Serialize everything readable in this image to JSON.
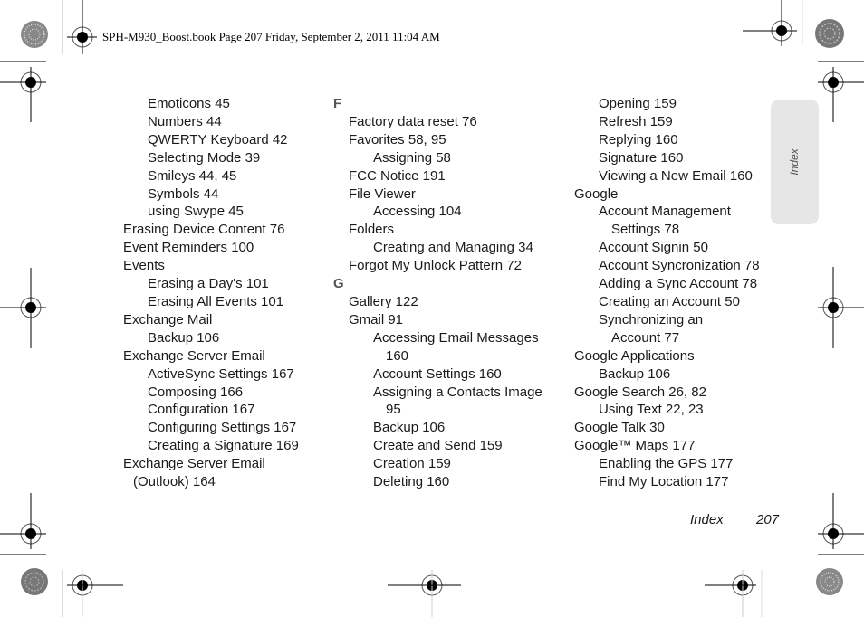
{
  "header": {
    "print_info": "SPH-M930_Boost.book  Page 207  Friday, September 2, 2011  11:04 AM"
  },
  "side_tab": {
    "label": "Index"
  },
  "footer": {
    "section": "Index",
    "page_number": "207"
  },
  "columns": [
    {
      "entries": [
        {
          "text": "Emoticons 45",
          "level": "lvl1"
        },
        {
          "text": "Numbers 44",
          "level": "lvl1"
        },
        {
          "text": "QWERTY Keyboard 42",
          "level": "lvl1"
        },
        {
          "text": "Selecting Mode 39",
          "level": "lvl1"
        },
        {
          "text": "Smileys 44, 45",
          "level": "lvl1"
        },
        {
          "text": "Symbols 44",
          "level": "lvl1"
        },
        {
          "text": "using Swype 45",
          "level": "lvl1"
        },
        {
          "text": "Erasing Device Content 76",
          "level": "lvl0"
        },
        {
          "text": "Event Reminders 100",
          "level": "lvl0"
        },
        {
          "text": "Events",
          "level": "lvl0"
        },
        {
          "text": "Erasing a Day's 101",
          "level": "lvl1"
        },
        {
          "text": "Erasing All Events 101",
          "level": "lvl1"
        },
        {
          "text": "Exchange Mail",
          "level": "lvl0"
        },
        {
          "text": "Backup 106",
          "level": "lvl1"
        },
        {
          "text": "Exchange Server Email",
          "level": "lvl0"
        },
        {
          "text": "ActiveSync Settings 167",
          "level": "lvl1"
        },
        {
          "text": "Composing 166",
          "level": "lvl1"
        },
        {
          "text": "Configuration 167",
          "level": "lvl1"
        },
        {
          "text": "Configuring Settings 167",
          "level": "lvl1"
        },
        {
          "text": "Creating a Signature 169",
          "level": "lvl1"
        },
        {
          "text": "Exchange Server Email",
          "level": "lvl0"
        },
        {
          "text": "(Outlook) 164",
          "level": "lvl0c"
        }
      ]
    },
    {
      "entries": [
        {
          "text": "F",
          "level": "letter"
        },
        {
          "text": "Factory data reset 76",
          "level": "lvl0"
        },
        {
          "text": "Favorites 58, 95",
          "level": "lvl0"
        },
        {
          "text": "Assigning 58",
          "level": "lvl1"
        },
        {
          "text": "FCC Notice 191",
          "level": "lvl0"
        },
        {
          "text": "File Viewer",
          "level": "lvl0"
        },
        {
          "text": "Accessing 104",
          "level": "lvl1"
        },
        {
          "text": "Folders",
          "level": "lvl0"
        },
        {
          "text": "Creating and Managing 34",
          "level": "lvl1"
        },
        {
          "text": "Forgot My Unlock Pattern 72",
          "level": "lvl0"
        },
        {
          "text": "G",
          "level": "letter"
        },
        {
          "text": "Gallery 122",
          "level": "lvl0"
        },
        {
          "text": "Gmail 91",
          "level": "lvl0"
        },
        {
          "text": "Accessing Email Messages",
          "level": "lvl1"
        },
        {
          "text": "160",
          "level": "lvl1c"
        },
        {
          "text": "Account Settings 160",
          "level": "lvl1"
        },
        {
          "text": "Assigning a Contacts Image",
          "level": "lvl1"
        },
        {
          "text": "95",
          "level": "lvl1c"
        },
        {
          "text": "Backup 106",
          "level": "lvl1"
        },
        {
          "text": "Create and Send 159",
          "level": "lvl1"
        },
        {
          "text": "Creation 159",
          "level": "lvl1"
        },
        {
          "text": "Deleting 160",
          "level": "lvl1"
        }
      ]
    },
    {
      "entries": [
        {
          "text": "Opening 159",
          "level": "lvl1"
        },
        {
          "text": "Refresh 159",
          "level": "lvl1"
        },
        {
          "text": "Replying 160",
          "level": "lvl1"
        },
        {
          "text": "Signature 160",
          "level": "lvl1"
        },
        {
          "text": "Viewing a New Email 160",
          "level": "lvl1"
        },
        {
          "text": "Google",
          "level": "lvl0"
        },
        {
          "text": "Account Management",
          "level": "lvl1"
        },
        {
          "text": "Settings 78",
          "level": "lvl1c"
        },
        {
          "text": "Account Signin 50",
          "level": "lvl1"
        },
        {
          "text": "Account Syncronization 78",
          "level": "lvl1"
        },
        {
          "text": "Adding a Sync Account 78",
          "level": "lvl1"
        },
        {
          "text": "Creating an Account 50",
          "level": "lvl1"
        },
        {
          "text": "Synchronizing an",
          "level": "lvl1"
        },
        {
          "text": "Account 77",
          "level": "lvl1c"
        },
        {
          "text": "Google Applications",
          "level": "lvl0"
        },
        {
          "text": "Backup 106",
          "level": "lvl1"
        },
        {
          "text": "Google Search 26, 82",
          "level": "lvl0"
        },
        {
          "text": "Using Text 22, 23",
          "level": "lvl1"
        },
        {
          "text": "Google Talk 30",
          "level": "lvl0"
        },
        {
          "text": "Google™ Maps 177",
          "level": "lvl0"
        },
        {
          "text": "Enabling the GPS 177",
          "level": "lvl1"
        },
        {
          "text": "Find My Location 177",
          "level": "lvl1"
        }
      ]
    }
  ]
}
